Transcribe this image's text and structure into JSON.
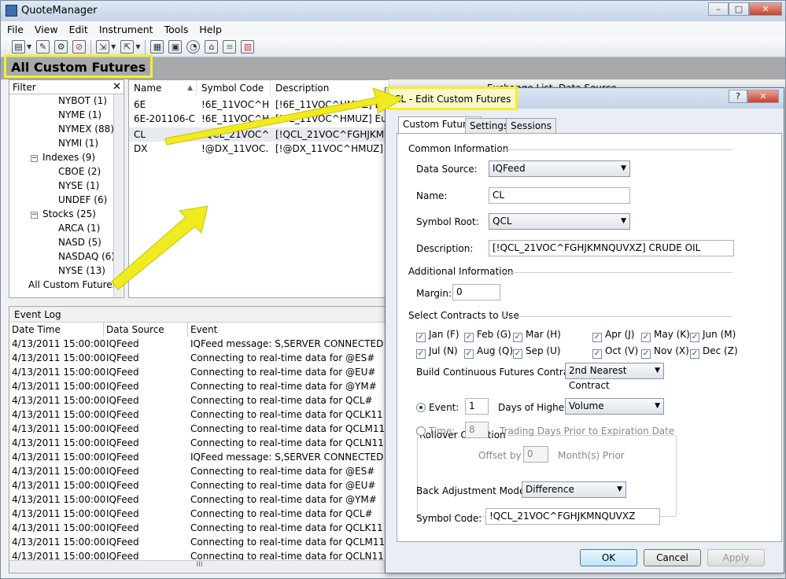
{
  "app": {
    "title": "QuoteManager"
  },
  "window_buttons": {
    "min": "–",
    "max": "□",
    "close": "✕"
  },
  "menu": [
    "File",
    "View",
    "Edit",
    "Instrument",
    "Tools",
    "Help"
  ],
  "header": {
    "title": "All Custom Futures"
  },
  "filter": {
    "label": "Filter",
    "close": "✕",
    "tree": [
      {
        "label": "NYBOT (1)"
      },
      {
        "label": "NYME (1)"
      },
      {
        "label": "NYMEX (88)"
      },
      {
        "label": "NYMI (1)"
      },
      {
        "label": "Indexes (9)"
      },
      {
        "label": "CBOE (2)"
      },
      {
        "label": "NYSE (1)"
      },
      {
        "label": "UNDEF (6)"
      },
      {
        "label": "Stocks (25)"
      },
      {
        "label": "ARCA (1)"
      },
      {
        "label": "NASD (5)"
      },
      {
        "label": "NASDAQ (6)"
      },
      {
        "label": "NYSE (13)"
      },
      {
        "label": "All Custom Futures"
      }
    ],
    "collapse_glyph": "−"
  },
  "grid": {
    "columns": [
      "Name",
      "Symbol Code",
      "Description",
      "Exchange List",
      "Data Source"
    ],
    "sort_glyph": "▲",
    "rows": [
      {
        "name": "6E",
        "symbol": "!6E_11VOC^H...",
        "desc": "[!6E_11VOC^HMUZ] E"
      },
      {
        "name": "6E-201106-C...",
        "symbol": "!6E_11VOC^H...",
        "desc": "[!6E_11VOC^HMUZ] Euro F"
      },
      {
        "name": "CL",
        "symbol": "!QCL_21VOC^...",
        "desc": "[!QCL_21VOC^FGHJKMNQ"
      },
      {
        "name": "DX",
        "symbol": "!@DX_11VOC...",
        "desc": "[!@DX_11VOC^HMUZ] Dol"
      }
    ]
  },
  "eventlog": {
    "title": "Event Log",
    "columns": [
      "Date Time",
      "Data Source",
      "Event"
    ],
    "rows": [
      {
        "dt": "4/13/2011  15:00:00",
        "src": "IQFeed",
        "ev": "IQFeed message: S,SERVER CONNECTED"
      },
      {
        "dt": "4/13/2011  15:00:00",
        "src": "IQFeed",
        "ev": "Connecting to real-time data for @ES#"
      },
      {
        "dt": "4/13/2011  15:00:00",
        "src": "IQFeed",
        "ev": "Connecting to real-time data for @EU#"
      },
      {
        "dt": "4/13/2011  15:00:00",
        "src": "IQFeed",
        "ev": "Connecting to real-time data for @YM#"
      },
      {
        "dt": "4/13/2011  15:00:00",
        "src": "IQFeed",
        "ev": "Connecting to real-time data for QCL#"
      },
      {
        "dt": "4/13/2011  15:00:00",
        "src": "IQFeed",
        "ev": "Connecting to real-time data for QCLK11"
      },
      {
        "dt": "4/13/2011  15:00:00",
        "src": "IQFeed",
        "ev": "Connecting to real-time data for QCLM11"
      },
      {
        "dt": "4/13/2011  15:00:00",
        "src": "IQFeed",
        "ev": "Connecting to real-time data for QCLN11"
      },
      {
        "dt": "4/13/2011  15:00:00",
        "src": "IQFeed",
        "ev": "IQFeed message: S,SERVER CONNECTED"
      },
      {
        "dt": "4/13/2011  15:00:00",
        "src": "IQFeed",
        "ev": "Connecting to real-time data for @ES#"
      },
      {
        "dt": "4/13/2011  15:00:00",
        "src": "IQFeed",
        "ev": "Connecting to real-time data for @EU#"
      },
      {
        "dt": "4/13/2011  15:00:00",
        "src": "IQFeed",
        "ev": "Connecting to real-time data for @YM#"
      },
      {
        "dt": "4/13/2011  15:00:00",
        "src": "IQFeed",
        "ev": "Connecting to real-time data for QCL#"
      },
      {
        "dt": "4/13/2011  15:00:00",
        "src": "IQFeed",
        "ev": "Connecting to real-time data for QCLK11"
      },
      {
        "dt": "4/13/2011  15:00:00",
        "src": "IQFeed",
        "ev": "Connecting to real-time data for QCLM11"
      },
      {
        "dt": "4/13/2011  15:00:00",
        "src": "IQFeed",
        "ev": "Connecting to real-time data for QCLN11"
      }
    ],
    "hscroll_grip": "III"
  },
  "dialog": {
    "title": "CL - Edit Custom Futures",
    "help": "?",
    "close": "✕",
    "tabs": [
      "Custom Futures",
      "Settings",
      "Sessions"
    ],
    "common_info": "Common Information",
    "data_source_label": "Data Source:",
    "data_source_value": "IQFeed",
    "name_label": "Name:",
    "name_value": "CL",
    "symbol_root_label": "Symbol Root:",
    "symbol_root_value": "QCL",
    "description_label": "Description:",
    "description_value": "[!QCL_21VOC^FGHJKMNQUVXZ] CRUDE OIL",
    "additional_info": "Additional Information",
    "margin_label": "Margin:",
    "margin_value": "0",
    "contracts_label": "Select Contracts to Use",
    "months": [
      "Jan (F)",
      "Feb (G)",
      "Mar (H)",
      "Apr (J)",
      "May (K)",
      "Jun (M)",
      "Jul (N)",
      "Aug (Q)",
      "Sep (U)",
      "Oct (V)",
      "Nov (X)",
      "Dec (Z)"
    ],
    "check_glyph": "✓",
    "build_label": "Build Continuous Futures Contract on:",
    "build_value": "2nd Nearest Contract",
    "rollover_label": "Rollover Condition",
    "event_label": "Event:",
    "event_days": "1",
    "days_of_higher": "Days of Higher",
    "higher_value": "Volume",
    "time_label": "Time:",
    "time_days": "8",
    "time_desc": "Trading Days Prior to Expiration Date",
    "offset_label": "Offset by",
    "offset_value": "0",
    "offset_unit": "Month(s) Prior",
    "back_adj_label": "Back Adjustment Mode:",
    "back_adj_value": "Difference",
    "symbol_code_label": "Symbol Code:",
    "symbol_code_value": "!QCL_21VOC^FGHJKMNQUVXZ",
    "ok": "OK",
    "cancel": "Cancel",
    "apply": "Apply"
  },
  "colors": {
    "highlight": "#f5ef2a",
    "header_bg": "#a7a9ab"
  }
}
